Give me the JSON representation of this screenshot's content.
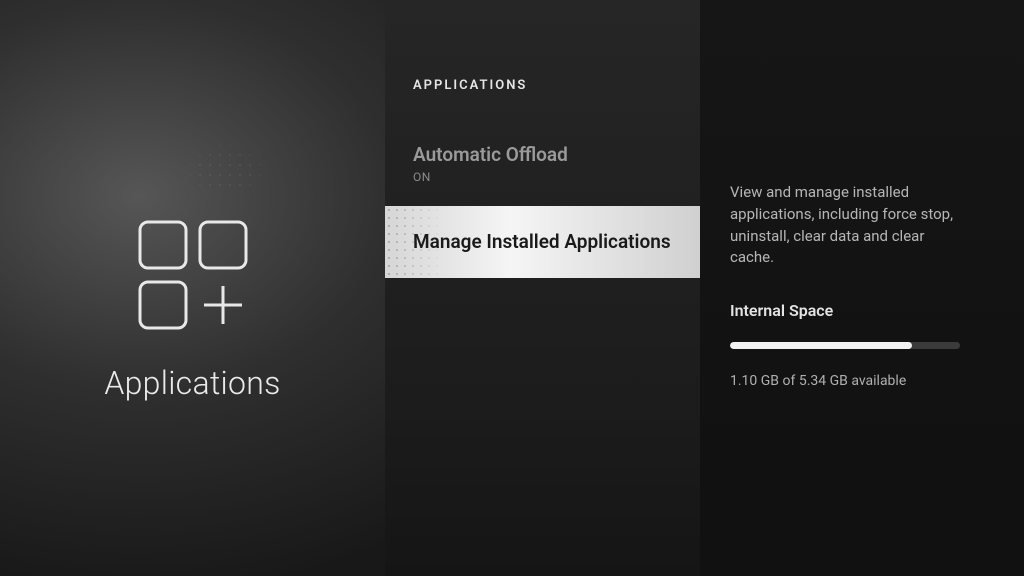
{
  "left": {
    "title": "Applications"
  },
  "middle": {
    "heading": "APPLICATIONS",
    "items": [
      {
        "title": "Automatic Offload",
        "sub": "ON",
        "selected": false
      },
      {
        "title": "Manage Installed Applications",
        "sub": "",
        "selected": true
      }
    ]
  },
  "right": {
    "description": "View and manage installed applications, including force stop, uninstall, clear data and clear cache.",
    "storage_heading": "Internal Space",
    "storage_text": "1.10 GB of 5.34 GB available",
    "storage_used_gb": 1.1,
    "storage_total_gb": 5.34,
    "storage_percent_used": 79
  }
}
